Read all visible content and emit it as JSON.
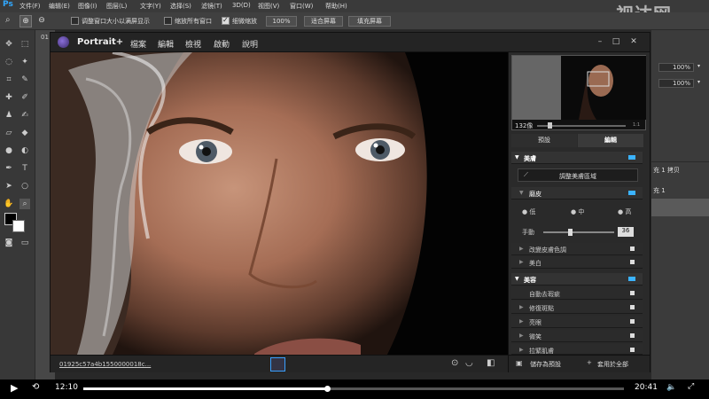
{
  "ps": {
    "logo": "Ps",
    "menu": [
      "文件(F)",
      "编辑(E)",
      "图像(I)",
      "图层(L)",
      "文字(Y)",
      "选择(S)",
      "滤镜(T)",
      "3D(D)",
      "视图(V)",
      "窗口(W)",
      "帮助(H)"
    ],
    "options": {
      "resize_windows_label": "调整窗口大小以满屏显示",
      "zoom_all_label": "缩放所有窗口",
      "scrubby_zoom_label": "细微缩放",
      "zoom_value": "100%",
      "fit_screen_label": "适合屏幕",
      "fill_screen_label": "填充屏幕"
    },
    "doc_tab_partial": "01",
    "right_panel": {
      "opacity_value": "100%",
      "fill_value": "100%",
      "layer1": "充 1 拷贝",
      "layer2": "充 1"
    }
  },
  "watermark": "视达网",
  "plugin": {
    "name": "Portrait+",
    "menu": [
      "檔案",
      "編輯",
      "檢視",
      "啟動",
      "說明"
    ],
    "side": {
      "zoom_label": "132像",
      "zoom_marker": "1:1",
      "tabs": [
        "預設",
        "編輯"
      ],
      "skin_section": "美膚",
      "adjust_skin_area_btn": "調整美膚區域",
      "smooth_sub": "磨皮",
      "levels": [
        "低",
        "中",
        "高"
      ],
      "manual_label": "手動",
      "manual_value": "36",
      "skin_tone_row": "改變皮膚色調",
      "whiten_row": "美白",
      "beauty_section": "美容",
      "auto_remove_row": "自動去瑕疵",
      "fix_blemish_row": "修復斑點",
      "bright_eyes_row": "亮眼",
      "smile_row": "微笑",
      "face_lift_row": "拉緊肌膚"
    },
    "bottom": {
      "filename": "01925c57a4b1550000018c...",
      "save_preset_label": "儲存為預設",
      "apply_all_label": "套用於全部"
    }
  },
  "player": {
    "current_time": "12:10",
    "total_time": "20:41",
    "progress": 0.45
  }
}
